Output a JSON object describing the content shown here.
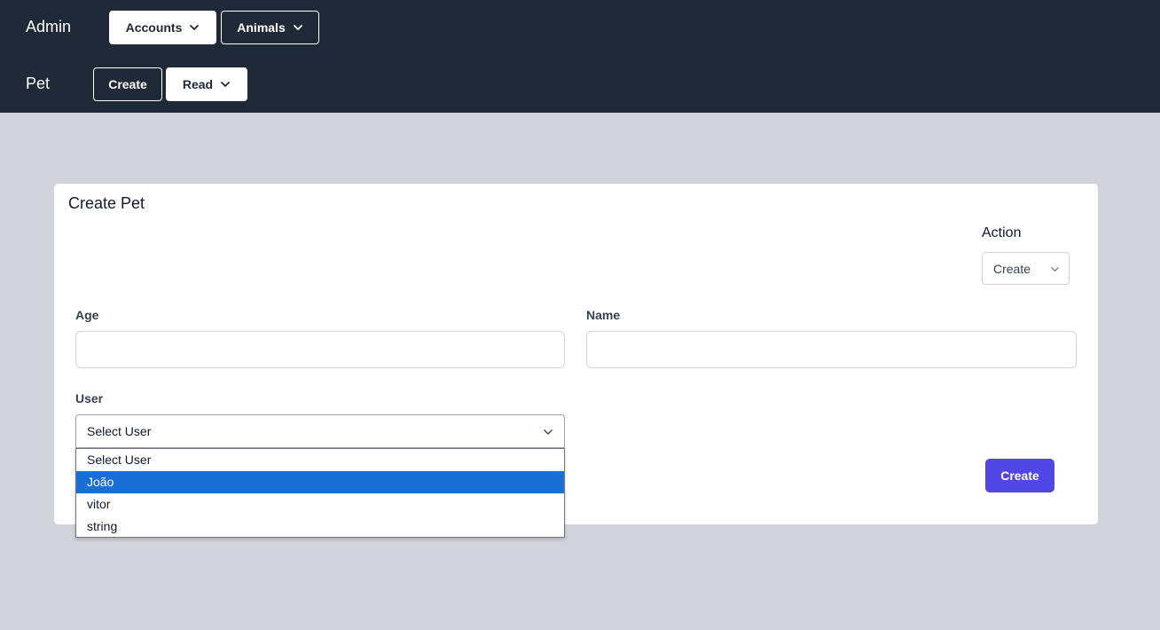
{
  "header": {
    "admin_label": "Admin",
    "accounts_label": "Accounts",
    "animals_label": "Animals",
    "pet_label": "Pet",
    "create_label": "Create",
    "read_label": "Read"
  },
  "form": {
    "title": "Create Pet",
    "action_label": "Action",
    "action_value": "Create",
    "age_label": "Age",
    "age_value": "",
    "name_label": "Name",
    "name_value": "",
    "user_label": "User",
    "user_value": "Select User",
    "submit_label": "Create"
  },
  "user_dropdown": {
    "options": [
      "Select User",
      "João",
      "vitor",
      "string"
    ],
    "highlighted_index": 1
  },
  "colors": {
    "header_bg": "#1f2937",
    "page_bg": "#d1d5db",
    "primary": "#4f46e5",
    "option_highlight": "#1a6fd6"
  }
}
